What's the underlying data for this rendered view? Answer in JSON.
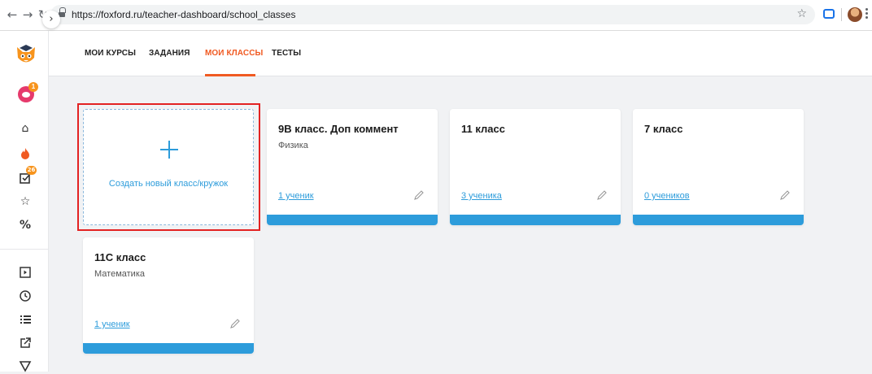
{
  "browser": {
    "url": "https://foxford.ru/teacher-dashboard/school_classes"
  },
  "sidebar": {
    "notification_count": "1",
    "tasks_badge": "26"
  },
  "tabs": [
    {
      "label": "МОИ КУРСЫ",
      "active": false
    },
    {
      "label": "ЗАДАНИЯ",
      "active": false
    },
    {
      "label": "МОИ КЛАССЫ",
      "active": true
    },
    {
      "label": "ТЕСТЫ",
      "active": false
    }
  ],
  "create_card": {
    "label": "Создать новый класс/кружок"
  },
  "classes": [
    {
      "title": "9В класс. Доп коммент",
      "subject": "Физика",
      "students": "1 ученик"
    },
    {
      "title": "11 класс",
      "subject": "",
      "students": "3 ученика"
    },
    {
      "title": "7 класс",
      "subject": "",
      "students": "0 учеников"
    },
    {
      "title": "11С класс",
      "subject": "Математика",
      "students": "1 ученик"
    }
  ],
  "colors": {
    "accent": "#f05a22",
    "link": "#2d9cdb",
    "highlight": "#e32222"
  }
}
